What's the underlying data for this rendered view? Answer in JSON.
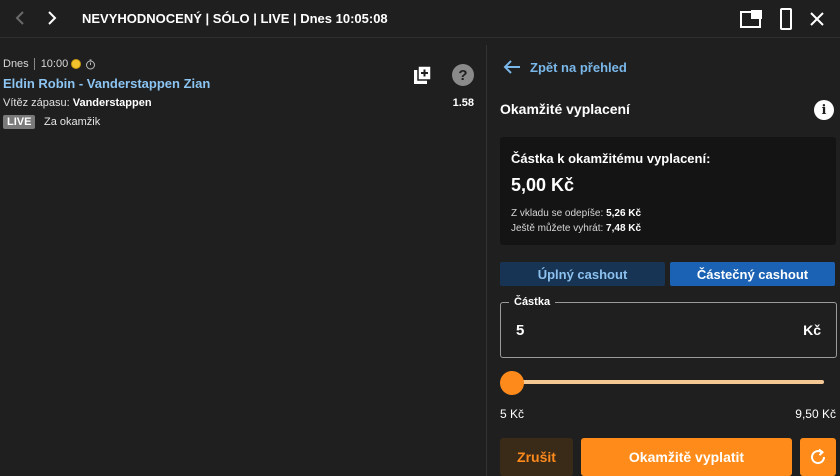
{
  "header": {
    "title": "NEVYHODNOCENÝ | SÓLO | LIVE | Dnes 10:05:08"
  },
  "ticket": {
    "day": "Dnes",
    "time": "10:00",
    "match": "Eldin Robin - Vanderstappen Zian",
    "market_label": "Vítěz zápasu:",
    "selection": "Vanderstappen",
    "odds": "1.58",
    "live_badge": "LIVE",
    "live_text": "Za okamžik",
    "help_glyph": "?"
  },
  "cashout": {
    "back_label": "Zpět na přehled",
    "title": "Okamžité vyplacení",
    "info_glyph": "i",
    "amount_label": "Částka k okamžitému vyplacení:",
    "amount_value": "5,00 Kč",
    "deduct_label": "Z vkladu se odepíše:",
    "deduct_value": "5,26 Kč",
    "win_label": "Ještě můžete vyhrát:",
    "win_value": "7,48 Kč",
    "tabs": {
      "full": "Úplný cashout",
      "partial": "Částečný cashout",
      "active": "partial"
    },
    "field": {
      "legend": "Částka",
      "value": "5",
      "unit": "Kč"
    },
    "slider": {
      "min_label": "5 Kč",
      "max_label": "9,50 Kč",
      "level": 0
    },
    "cancel_label": "Zrušit",
    "confirm_label": "Okamžitě vyplatit"
  },
  "icons": {
    "nav_prev": "chevron-left-icon",
    "nav_next": "chevron-right-icon",
    "pip": "picture-in-picture-icon",
    "phone": "mobile-view-icon",
    "close": "close-icon",
    "copy": "copy-add-icon",
    "help": "help-icon",
    "back": "arrow-left-icon",
    "info": "info-icon",
    "refresh": "refresh-icon"
  },
  "colors": {
    "background": "#1f1f1f",
    "link_blue": "#7ab8ea",
    "accent_orange": "#ff8c1a",
    "tab_active": "#1b62b4",
    "tab_inactive": "#173454"
  }
}
